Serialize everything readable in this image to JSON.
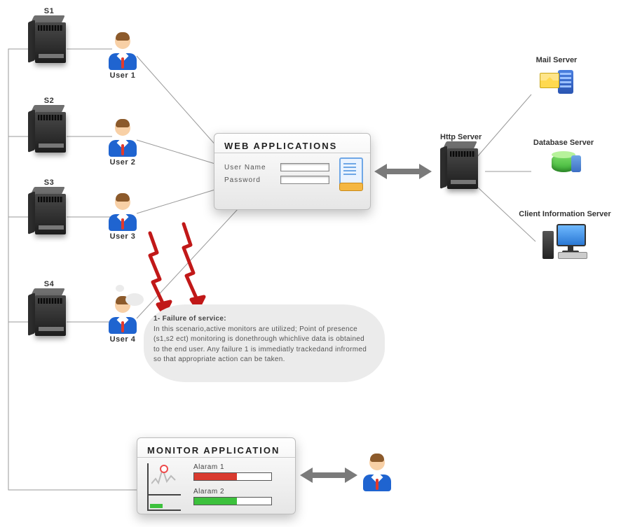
{
  "servers": {
    "s1": "S1",
    "s2": "S2",
    "s3": "S3",
    "s4": "S4"
  },
  "users": {
    "u1": "User 1",
    "u2": "User 2",
    "u3": "User 3",
    "u4": "User 4"
  },
  "web_app": {
    "title": "WEB APPLICATIONS",
    "username_label": "User Name",
    "password_label": "Password"
  },
  "http_server_label": "Http Server",
  "mail_server_label": "Mail Server",
  "database_server_label": "Database Server",
  "client_info_server_label": "Client Information Server",
  "monitor_app": {
    "title": "MONITOR APPLICATION",
    "alarm1_label": "Alaram 1",
    "alarm2_label": "Alaram 2"
  },
  "callout": {
    "heading": "1- Failure of service:",
    "body": "In this scenario,active monitors are utilized; Point of presence (s1,s2 ect) monitoring is donethrough whichlive data is obtained to the end user.  Any failure 1 is immediatly trackedand infrormed so that appropriate action can be taken."
  }
}
